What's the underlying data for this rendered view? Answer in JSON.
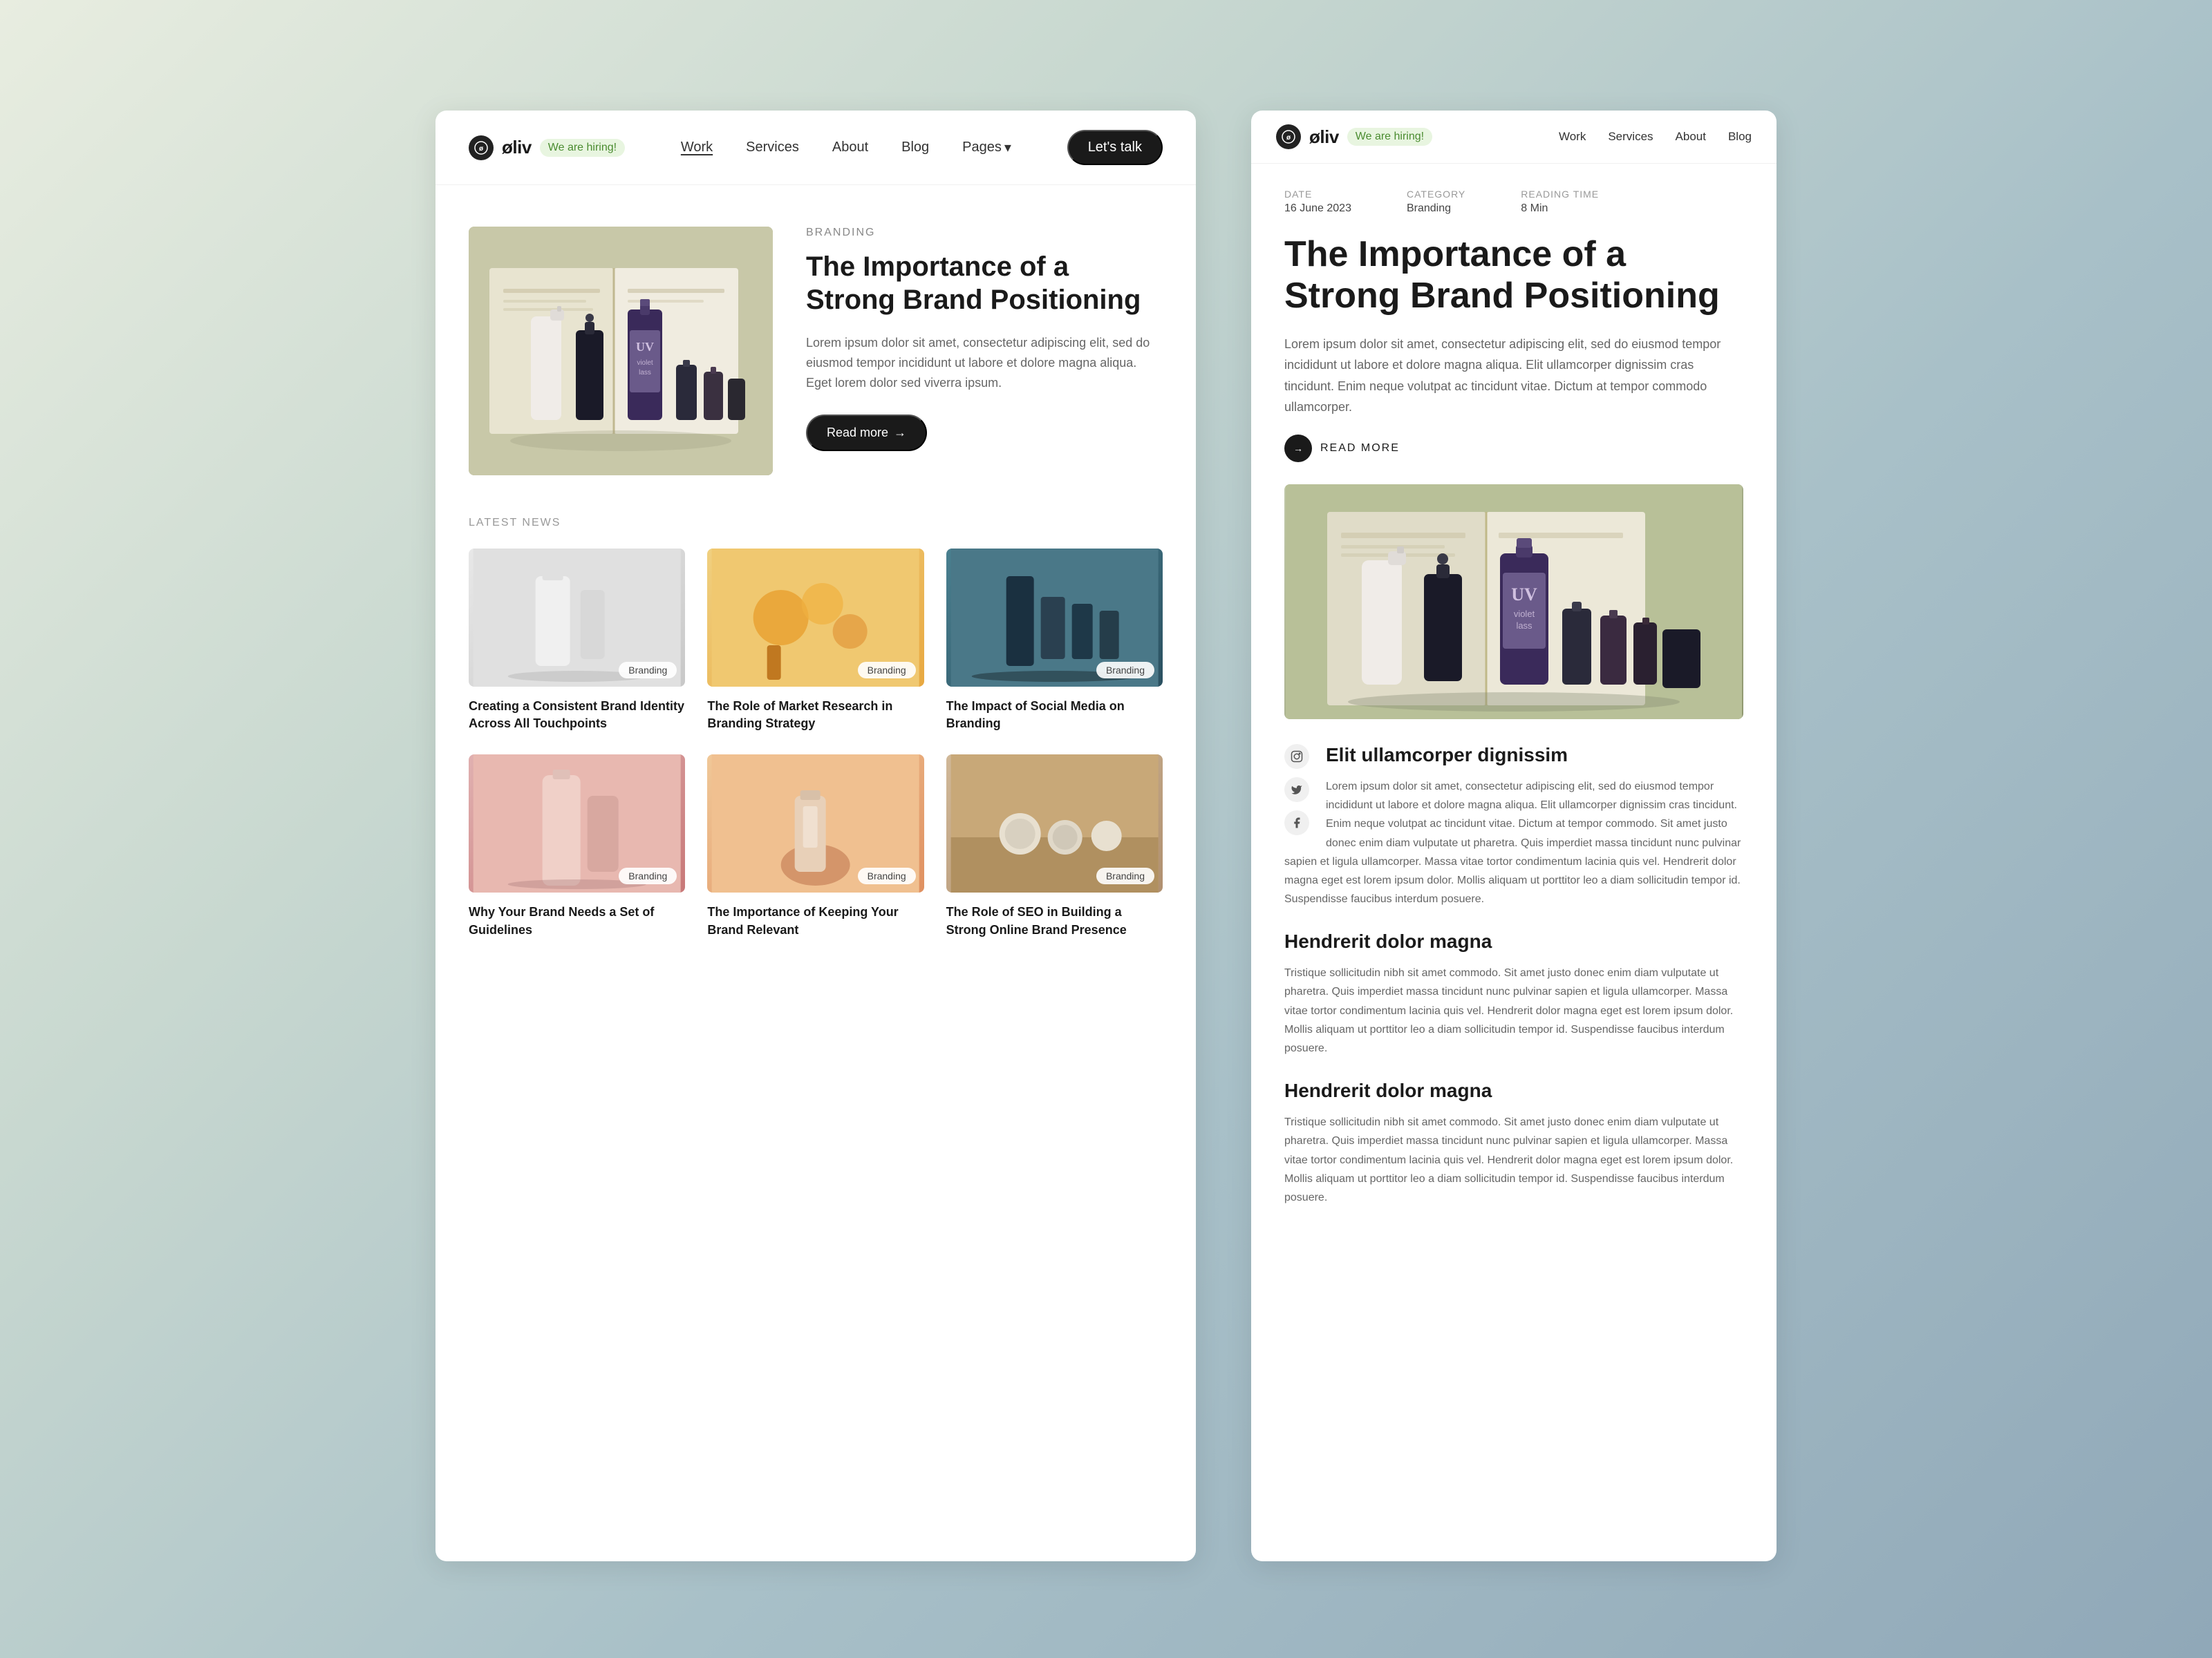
{
  "left_card": {
    "nav": {
      "logo_text": "øliv",
      "hiring_label": "We are hiring!",
      "links": [
        {
          "label": "Work",
          "active": true
        },
        {
          "label": "Services",
          "active": false
        },
        {
          "label": "About",
          "active": false
        },
        {
          "label": "Blog",
          "active": false
        },
        {
          "label": "Pages",
          "active": false,
          "has_dropdown": true
        }
      ],
      "cta_label": "Let's talk"
    },
    "hero": {
      "category": "BRANDING",
      "title": "The Importance of a Strong Brand Positioning",
      "description": "Lorem ipsum dolor sit amet, consectetur adipiscing elit, sed do eiusmod tempor incididunt ut labore et dolore magna aliqua. Eget lorem dolor sed viverra ipsum.",
      "read_more": "Read more"
    },
    "latest_news": {
      "section_label": "LATEST NEWS",
      "items": [
        {
          "title": "Creating a Consistent Brand Identity Across All Touchpoints",
          "badge": "Branding",
          "thumb_class": "thumb-gray"
        },
        {
          "title": "The Role of Market Research in Branding Strategy",
          "badge": "Branding",
          "thumb_class": "thumb-orange"
        },
        {
          "title": "The Impact of Social Media on Branding",
          "badge": "Branding",
          "thumb_class": "thumb-teal"
        },
        {
          "title": "Why Your Brand Needs a Set of Guidelines",
          "badge": "Branding",
          "thumb_class": "thumb-pink"
        },
        {
          "title": "The Importance of Keeping Your Brand Relevant",
          "badge": "Branding",
          "thumb_class": "thumb-peach"
        },
        {
          "title": "The Role of SEO in Building a Strong Online Brand Presence",
          "badge": "Branding",
          "thumb_class": "thumb-warm"
        }
      ]
    }
  },
  "right_card": {
    "nav": {
      "logo_text": "øliv",
      "hiring_label": "We are hiring!",
      "links": [
        {
          "label": "Work"
        },
        {
          "label": "Services"
        },
        {
          "label": "About"
        },
        {
          "label": "Blog"
        }
      ]
    },
    "article": {
      "meta": {
        "date_label": "DATE",
        "date_val": "16 June 2023",
        "category_label": "CATEGORY",
        "category_val": "Branding",
        "reading_label": "READING TIME",
        "reading_val": "8 Min"
      },
      "title": "The Importance of a Strong Brand Positioning",
      "lead": "Lorem ipsum dolor sit amet, consectetur adipiscing elit, sed do eiusmod tempor incididunt ut labore et dolore magna aliqua. Elit ullamcorper dignissim cras tincidunt. Enim neque volutpat ac tincidunt vitae. Dictum at tempor commodo ullamcorper.",
      "read_more": "READ MORE",
      "body_heading1": "Elit ullamcorper dignissim",
      "body_text1": "Lorem ipsum dolor sit amet, consectetur adipiscing elit, sed do eiusmod tempor incididunt ut labore et dolore magna aliqua. Elit ullamcorper dignissim cras tincidunt. Enim neque volutpat ac tincidunt vitae. Dictum at tempor commodo. Sit amet justo donec enim diam vulputate ut pharetra. Quis imperdiet massa tincidunt nunc pulvinar sapien et ligula ullamcorper. Massa vitae tortor condimentum lacinia quis vel. Hendrerit dolor magna eget est lorem ipsum dolor. Mollis aliquam ut porttitor leo a diam sollicitudin tempor id. Suspendisse faucibus interdum posuere.",
      "body_heading2": "Hendrerit dolor magna",
      "body_text2": "Tristique sollicitudin nibh sit amet commodo. Sit amet justo donec enim diam vulputate ut pharetra. Quis imperdiet massa tincidunt nunc pulvinar sapien et ligula ullamcorper. Massa vitae tortor condimentum lacinia quis vel. Hendrerit dolor magna eget est lorem ipsum dolor. Mollis aliquam ut porttitor leo a diam sollicitudin tempor id. Suspendisse faucibus interdum posuere.",
      "body_heading3": "Hendrerit dolor magna",
      "body_text3": "Tristique sollicitudin nibh sit amet commodo. Sit amet justo donec enim diam vulputate ut pharetra. Quis imperdiet massa tincidunt nunc pulvinar sapien et ligula ullamcorper. Massa vitae tortor condimentum lacinia quis vel. Hendrerit dolor magna eget est lorem ipsum dolor. Mollis aliquam ut porttitor leo a diam sollicitudin tempor id. Suspendisse faucibus interdum posuere."
    }
  }
}
